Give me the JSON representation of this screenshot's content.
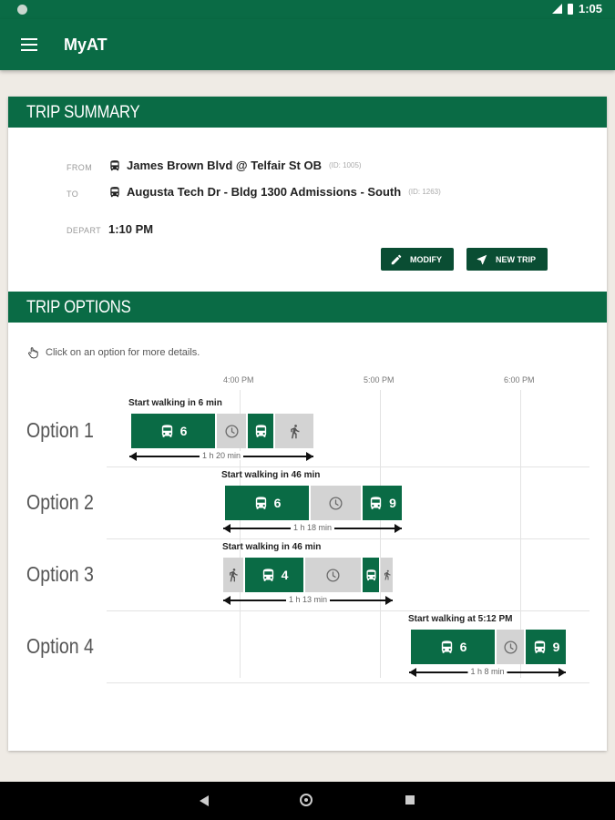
{
  "status_bar": {
    "time": "1:05"
  },
  "app": {
    "title": "MyAT"
  },
  "trip_summary": {
    "title": "TRIP SUMMARY",
    "from_label": "FROM",
    "from_stop": "James Brown Blvd @ Telfair St OB",
    "from_id": "(ID: 1005)",
    "to_label": "TO",
    "to_stop": "Augusta Tech Dr - Bldg 1300 Admissions - South",
    "to_id": "(ID: 1263)",
    "depart_label": "DEPART",
    "depart_time": "1:10 PM",
    "modify_label": "MODIFY",
    "new_trip_label": "NEW TRIP"
  },
  "trip_options": {
    "title": "TRIP OPTIONS",
    "hint": "Click on an option for more details.",
    "time_ticks": [
      "4:00 PM",
      "5:00 PM",
      "6:00 PM"
    ],
    "options": [
      {
        "label": "Option 1",
        "start": "Start walking in 6 min",
        "duration": "1 h 20 min",
        "route_a": "6"
      },
      {
        "label": "Option 2",
        "start": "Start walking in 46 min",
        "duration": "1 h 18 min",
        "route_a": "6",
        "route_b": "9"
      },
      {
        "label": "Option 3",
        "start": "Start walking in 46 min",
        "duration": "1 h 13 min",
        "route_a": "4"
      },
      {
        "label": "Option 4",
        "start": "Start walking at 5:12 PM",
        "duration": "1 h 8 min",
        "route_a": "6",
        "route_b": "9"
      }
    ]
  },
  "colors": {
    "primary": "#0a6b45",
    "button_dark": "#0a4d33",
    "segment_grey": "#d3d3d3"
  },
  "icons": [
    "menu-icon",
    "bus-icon",
    "pencil-icon",
    "navigation-arrow-icon",
    "hand-pointer-icon",
    "clock-icon",
    "walk-icon"
  ]
}
